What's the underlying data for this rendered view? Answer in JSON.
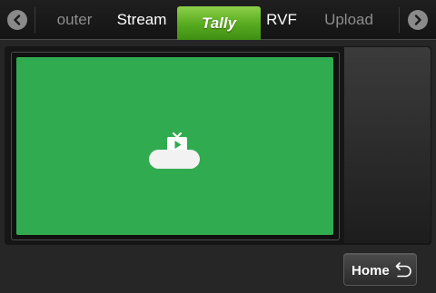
{
  "tabs": [
    {
      "label": "outer",
      "state": "faded"
    },
    {
      "label": "Stream",
      "state": "normal"
    },
    {
      "label": "Tally",
      "state": "active"
    },
    {
      "label": "RVF",
      "state": "normal"
    },
    {
      "label": "Upload",
      "state": "faded"
    }
  ],
  "nav": {
    "prev_icon": "chevron-left-icon",
    "next_icon": "chevron-right-icon"
  },
  "preview": {
    "tally_color": "#31ab4f",
    "icon": "tv-play-icon",
    "status_text": ""
  },
  "home_button": {
    "label": "Home",
    "icon": "return-arrow-icon"
  },
  "colors": {
    "accent": "#57a91e",
    "background": "#262626"
  }
}
